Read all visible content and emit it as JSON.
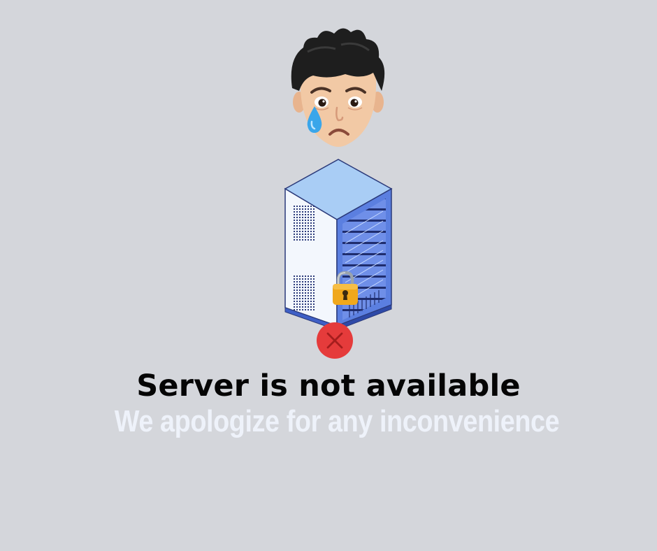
{
  "message": {
    "title": "Server is not available",
    "subtitle": "We apologize for any inconvenience"
  },
  "icons": {
    "avatar": "crying-avatar-icon",
    "server": "server-rack-icon",
    "lock": "padlock-icon",
    "error": "close-icon"
  },
  "colors": {
    "background": "#d4d6db",
    "title": "#050505",
    "subtitle": "#eef2fa",
    "error_badge": "#e53b3b",
    "lock": "#f0a81c",
    "server_top": "#a9cdf5",
    "server_side": "#5b7fe0"
  }
}
